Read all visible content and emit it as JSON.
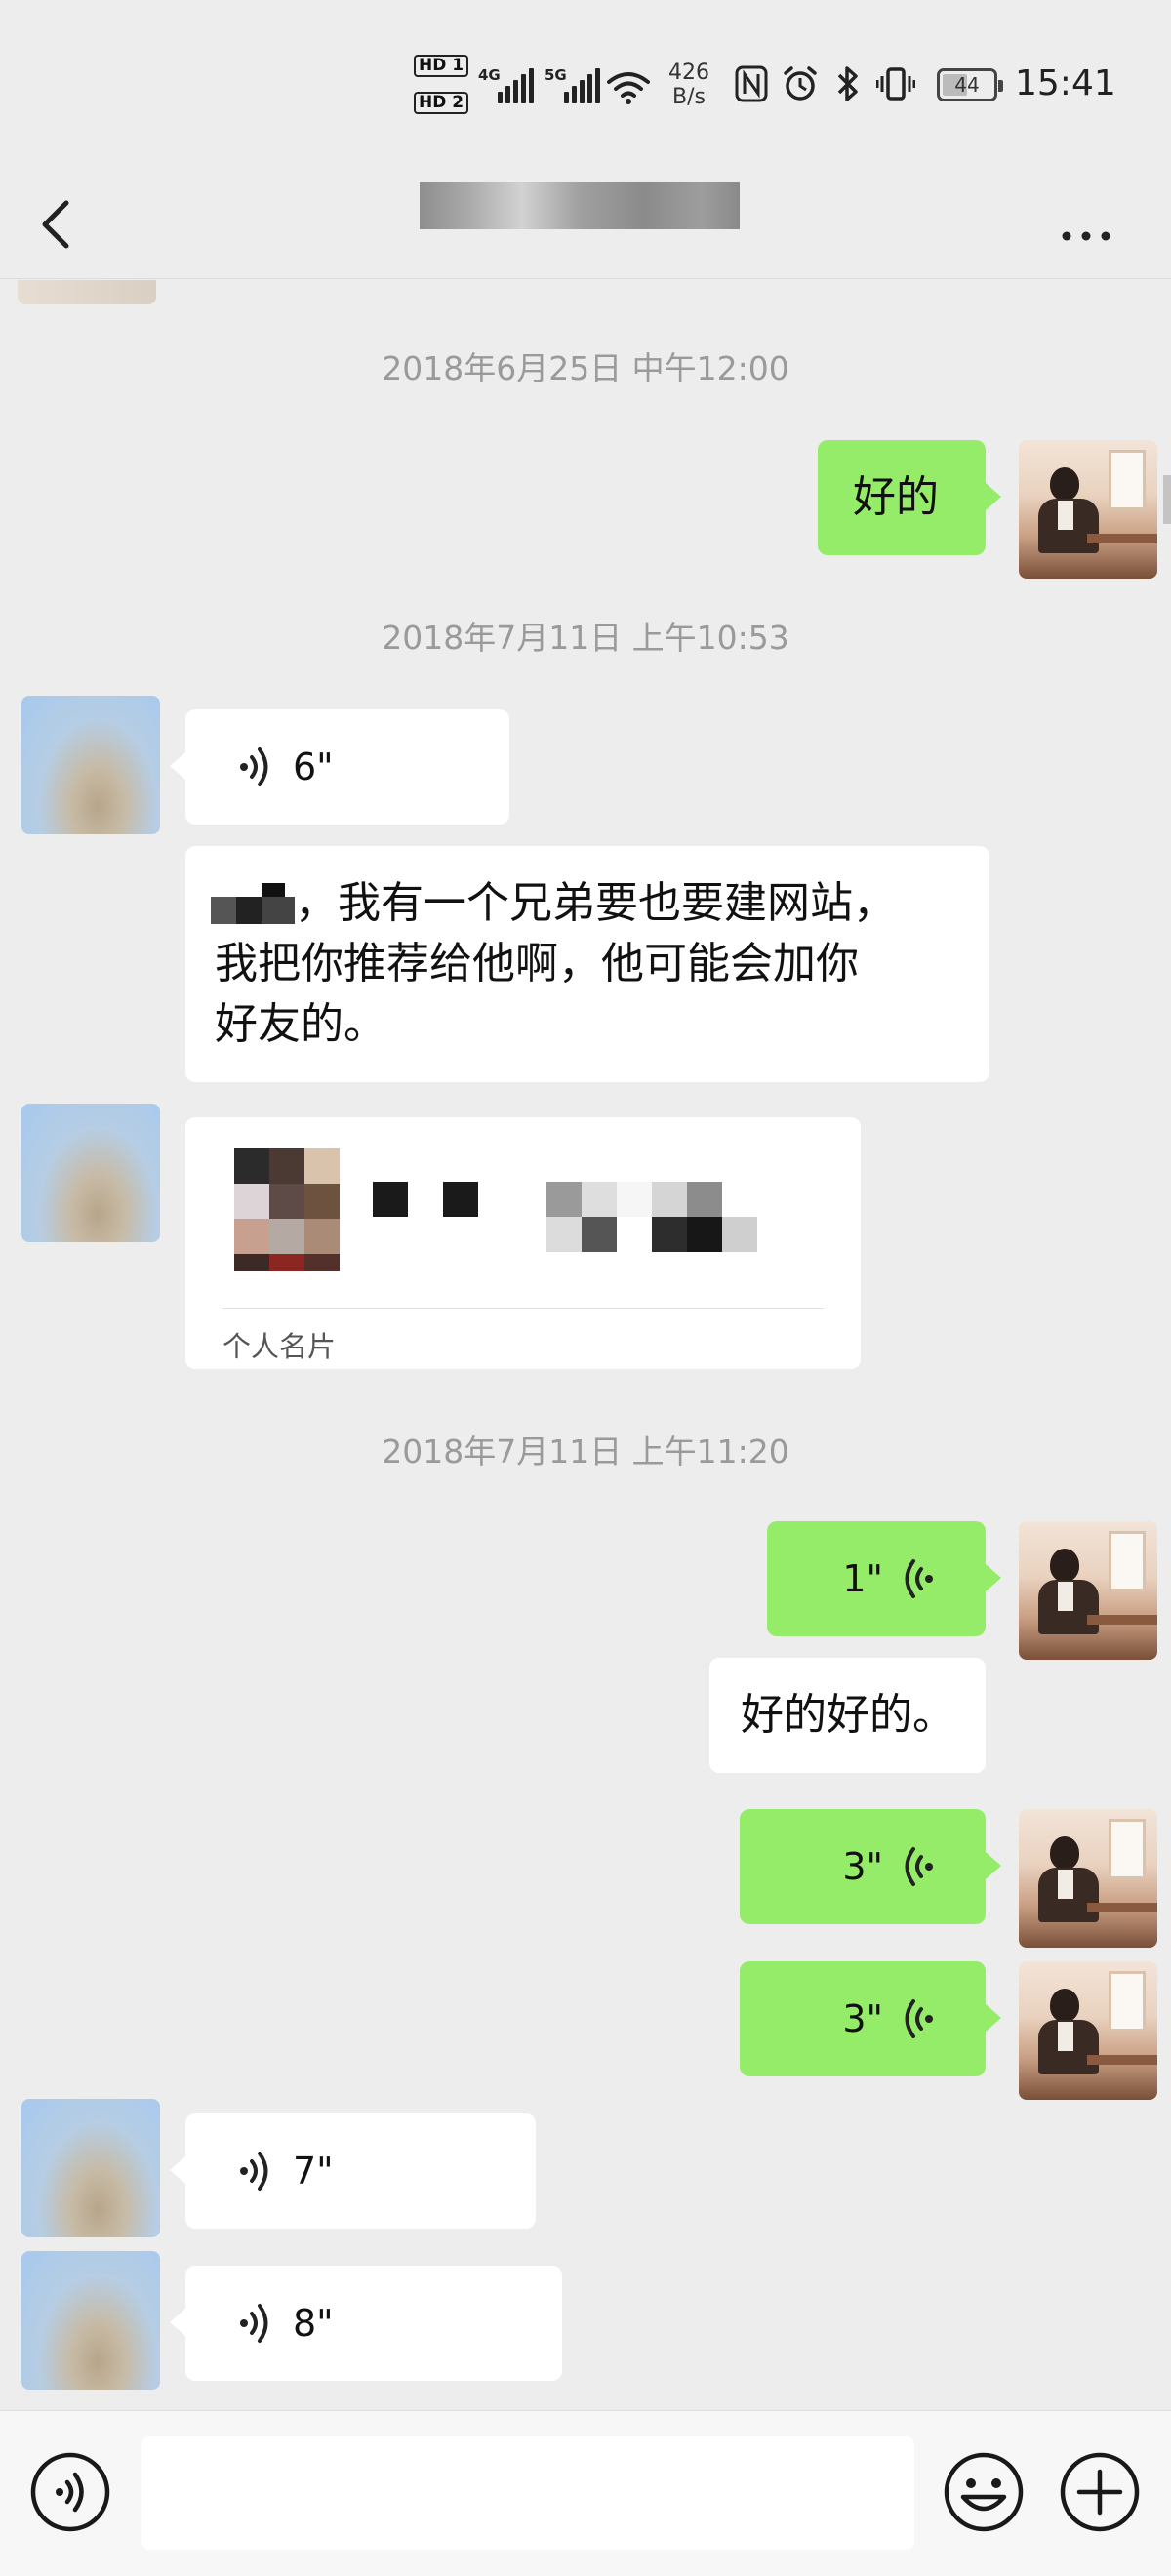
{
  "status_bar": {
    "hd_1": "HD 1",
    "hd_2": "HD 2",
    "signal_1_label": "4G",
    "signal_2_label": "5G",
    "net_speed_value": "426",
    "net_speed_unit": "B/s",
    "battery_level": "44",
    "time": "15:41"
  },
  "chat": {
    "timestamps": [
      "2018年6月25日 中午12:00",
      "2018年7月11日 上午10:53",
      "2018年7月11日 上午11:20"
    ],
    "messages": {
      "m1_text": "好的",
      "m2_voice_duration": "6\"",
      "m3_line1": "，我有一个兄弟要也要建网站，",
      "m3_line2": "我把你推荐给他啊，他可能会加你",
      "m3_line3": "好友的。",
      "m4_card_label": "个人名片",
      "m5_voice_duration": "1\"",
      "m6_text": "好的好的。",
      "m7_voice_duration": "3\"",
      "m8_voice_duration": "3\"",
      "m9_voice_duration": "7\"",
      "m10_voice_duration": "8\""
    }
  },
  "colors": {
    "background": "#ededed",
    "outgoing_bubble": "#95ec69",
    "incoming_bubble": "#ffffff",
    "timestamp_text": "#9a9a9a"
  },
  "icons": {
    "back": "chevron-left-icon",
    "more": "more-dots-icon",
    "voice_mode": "voice-mode-icon",
    "emoji": "emoji-icon",
    "add": "plus-icon"
  }
}
